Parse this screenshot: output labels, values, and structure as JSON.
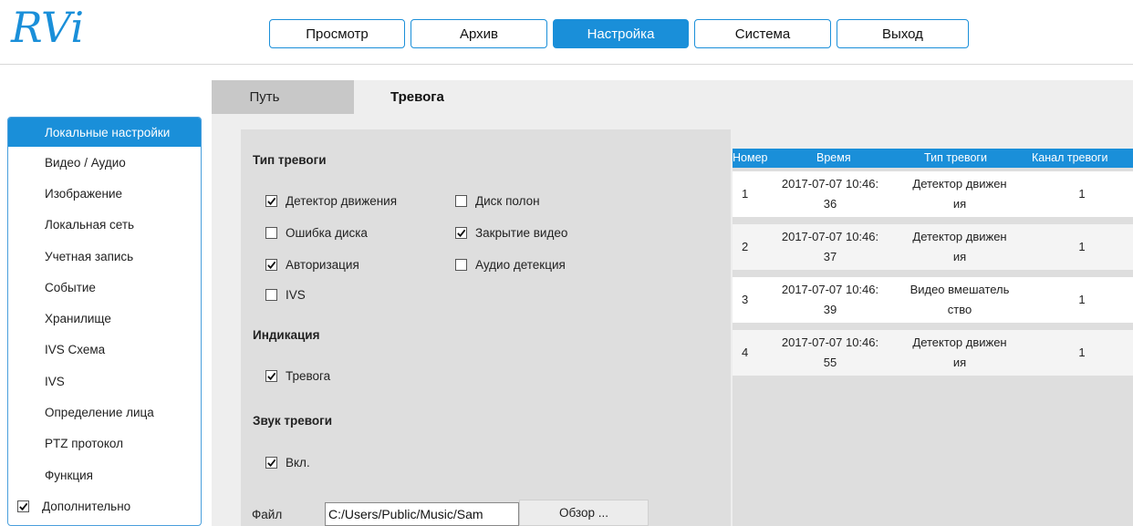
{
  "logo": {
    "text": "RVi",
    "color": "#1a8fd9"
  },
  "nav": [
    {
      "label": "Просмотр",
      "active": false
    },
    {
      "label": "Архив",
      "active": false
    },
    {
      "label": "Настройка",
      "active": true
    },
    {
      "label": "Система",
      "active": false
    },
    {
      "label": "Выход",
      "active": false
    }
  ],
  "tabs": {
    "path": "Путь",
    "alarm": "Тревога"
  },
  "sidebar": {
    "items": [
      "Локальные настройки",
      "Видео / Аудио",
      "Изображение",
      "Локальная сеть",
      "Учетная запись",
      "Событие",
      "Хранилище",
      "IVS Схема",
      "IVS",
      "Определение лица",
      "PTZ протокол",
      "Функция"
    ],
    "active_index": 0,
    "extra": {
      "label": "Дополнительно",
      "checked": true
    }
  },
  "alarm_type": {
    "title": "Тип тревоги",
    "motion": {
      "label": "Детектор движения",
      "checked": true
    },
    "disk_full": {
      "label": "Диск полон",
      "checked": false
    },
    "disk_error": {
      "label": "Ошибка диска",
      "checked": false
    },
    "video_tamper": {
      "label": "Закрытие видео",
      "checked": true
    },
    "auth": {
      "label": "Авторизация",
      "checked": true
    },
    "audio": {
      "label": "Аудио детекция",
      "checked": false
    },
    "ivs": {
      "label": "IVS",
      "checked": false
    }
  },
  "indication": {
    "title": "Индикация",
    "alarm": {
      "label": "Тревога",
      "checked": true
    }
  },
  "sound": {
    "title": "Звук тревоги",
    "on": {
      "label": "Вкл.",
      "checked": true
    }
  },
  "file": {
    "label": "Файл",
    "value": "C:/Users/Public/Music/Sam",
    "browse": "Обзор ..."
  },
  "log": {
    "headers": {
      "num": "Номер",
      "time": "Время",
      "type": "Тип тревоги",
      "channel": "Канал тревоги"
    },
    "rows": [
      {
        "num": "1",
        "time1": "2017-07-07 10:46:",
        "time2": "36",
        "type1": "Детектор движен",
        "type2": "ия",
        "channel": "1"
      },
      {
        "num": "2",
        "time1": "2017-07-07 10:46:",
        "time2": "37",
        "type1": "Детектор движен",
        "type2": "ия",
        "channel": "1"
      },
      {
        "num": "3",
        "time1": "2017-07-07 10:46:",
        "time2": "39",
        "type1": "Видео вмешатель",
        "type2": "ство",
        "channel": "1"
      },
      {
        "num": "4",
        "time1": "2017-07-07 10:46:",
        "time2": "55",
        "type1": "Детектор движен",
        "type2": "ия",
        "channel": "1"
      }
    ]
  },
  "colors": {
    "accent": "#1a8fd9",
    "panel": "#dedede",
    "background": "#eeeeee"
  }
}
